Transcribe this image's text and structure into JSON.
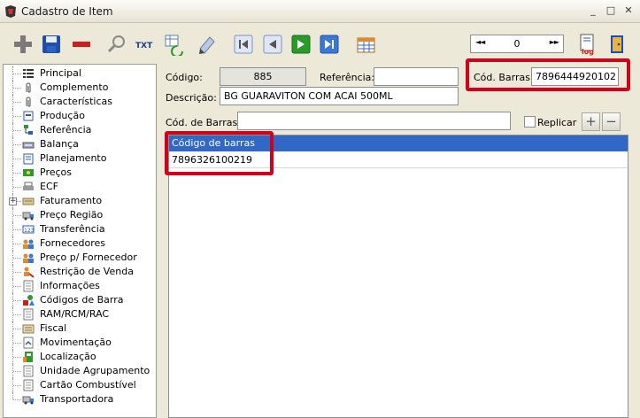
{
  "window": {
    "title": "Cadastro de Item",
    "minimize": "_",
    "maximize": "□",
    "close": "✕"
  },
  "toolbar": {
    "txt_label": "TXT",
    "log_label": "log",
    "record_nav": {
      "prev": "◄◄",
      "next": "►►",
      "value": "0"
    }
  },
  "sidebar": {
    "items": [
      {
        "label": "Principal",
        "icon": "list-icon"
      },
      {
        "label": "Complemento",
        "icon": "paperclip-icon"
      },
      {
        "label": "Características",
        "icon": "paperclip-icon"
      },
      {
        "label": "Produção",
        "icon": "production-icon"
      },
      {
        "label": "Referência",
        "icon": "reference-icon"
      },
      {
        "label": "Balança",
        "icon": "scale-icon"
      },
      {
        "label": "Planejamento",
        "icon": "planning-icon"
      },
      {
        "label": "Preços",
        "icon": "money-icon"
      },
      {
        "label": "ECF",
        "icon": "printer-icon"
      },
      {
        "label": "Faturamento",
        "icon": "invoice-icon",
        "expandable": true
      },
      {
        "label": "Preço Região",
        "icon": "truck-icon"
      },
      {
        "label": "Transferência",
        "icon": "transfer-icon"
      },
      {
        "label": "Fornecedores",
        "icon": "suppliers-icon"
      },
      {
        "label": "Preço p/ Fornecedor",
        "icon": "suppliers-icon"
      },
      {
        "label": "Restrição de Venda",
        "icon": "restriction-icon"
      },
      {
        "label": "Informações",
        "icon": "document-icon"
      },
      {
        "label": "Códigos de Barra",
        "icon": "shapes-icon"
      },
      {
        "label": "RAM/RCM/RAC",
        "icon": "document-icon"
      },
      {
        "label": "Fiscal",
        "icon": "fiscal-icon"
      },
      {
        "label": "Movimentação",
        "icon": "movement-icon"
      },
      {
        "label": "Localização",
        "icon": "location-icon"
      },
      {
        "label": "Unidade Agrupamento",
        "icon": "document-icon"
      },
      {
        "label": "Cartão Combustível",
        "icon": "document-icon"
      },
      {
        "label": "Transportadora",
        "icon": "truck-icon"
      }
    ]
  },
  "form": {
    "codigo_label": "Código:",
    "codigo_value": "885",
    "referencia_label": "Referência:",
    "referencia_value": "",
    "cod_barras_label": "Cód. Barras:",
    "cod_barras_value": "7896444920102",
    "descricao_label": "Descrição:",
    "descricao_value": "BG GUARAVITON COM ACAI 500ML",
    "cod_de_barras_label": "Cód. de Barras:",
    "cod_de_barras_value": "",
    "replicar_label": "Replicar",
    "add_btn": "+",
    "remove_btn": "−"
  },
  "grid": {
    "header": "Código de barras",
    "rows": [
      "7896326100219"
    ]
  },
  "colors": {
    "highlight": "#d0021b",
    "grid_header": "#3167c6",
    "window_bg": "#ece9d8"
  }
}
